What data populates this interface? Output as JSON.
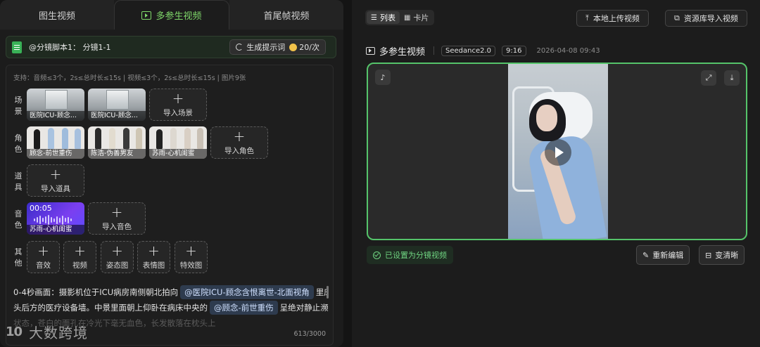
{
  "left": {
    "tabs": [
      {
        "label": "图生视频",
        "active": false
      },
      {
        "label": "多参生视频",
        "active": true
      },
      {
        "label": "首尾帧视频",
        "active": false
      }
    ],
    "script_label": "@分镜脚本1：  分镜1-1",
    "generate_button": "生成提示词",
    "generate_cost": "20/次",
    "support_text": "支持：音频≤3个，2s≤总时长≤15s | 视频≤3个，2s≤总时长≤15s | 图片9张",
    "rows": {
      "scene": {
        "label": "场景",
        "assets": [
          "医院ICU-顾念...",
          "医院ICU-顾念..."
        ],
        "add_label": "导入场景"
      },
      "character": {
        "label": "角色",
        "assets": [
          "顾念-前世重伤",
          "陈浩-伪善男友",
          "苏雨-心机闺蜜"
        ],
        "add_label": "导入角色"
      },
      "prop": {
        "label": "道具",
        "add_label": "导入道具"
      },
      "voice": {
        "label": "音色",
        "audio_time": "00:05",
        "audio_name": "苏雨-心机闺蜜",
        "add_label": "导入音色"
      },
      "other": {
        "label": "其他",
        "items": [
          "音效",
          "视频",
          "姿态图",
          "表情图",
          "特效图"
        ]
      }
    },
    "prompt": {
      "line1_a": "0-4秒画面：摄影机位于ICU病房南侧朝北拍向",
      "mention1": "@医院ICU-顾念含恨离世-北面视角",
      "line1_b": "里床",
      "line2_a": "头后方的医疗设备墙。中景里面朝上仰卧在病床中央的",
      "mention2": "@顾念-前世重伤",
      "line2_b": "呈绝对静止濒死",
      "line3": "状态，苍白的面孔在冷光下毫无血色，长发散落在枕头上"
    },
    "char_count": "613/3000",
    "watermark": {
      "logo": "10",
      "text": "大数跨境"
    }
  },
  "right": {
    "view_toggle": [
      {
        "label": "列表",
        "active": true
      },
      {
        "label": "卡片",
        "active": false
      }
    ],
    "upload_local": "本地上传视频",
    "import_library": "资源库导入视频",
    "video_title": "多参生视频",
    "model_tag": "Seedance2.0",
    "ratio_tag": "9:16",
    "timestamp": "2026-04-08 09:43",
    "status_badge": "已设置为分镜视频",
    "reedit_button": "重新编辑",
    "upscale_button": "变清晰"
  },
  "colors": {
    "accent_green": "#7fd86a",
    "player_border": "#55c46a",
    "mention_bg": "#2e3b4e"
  }
}
